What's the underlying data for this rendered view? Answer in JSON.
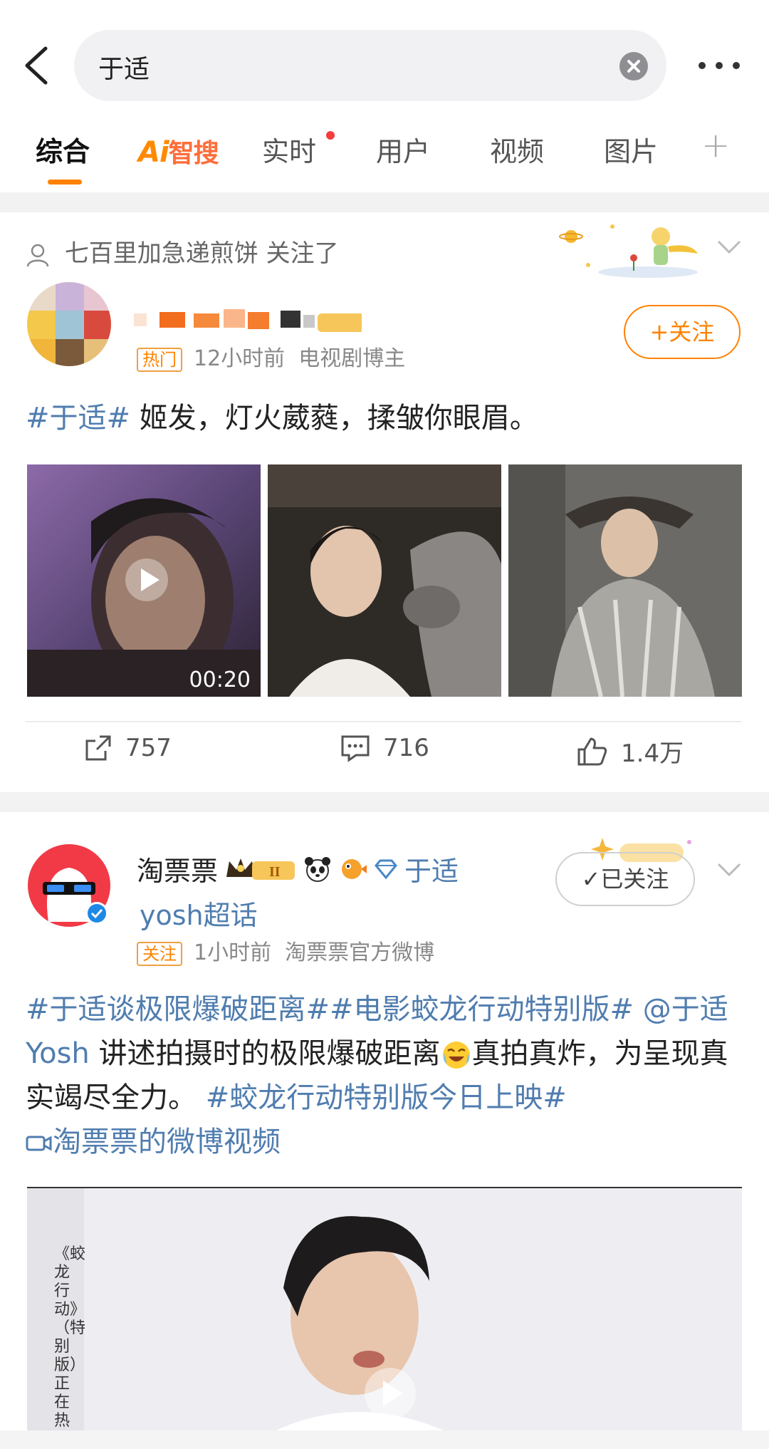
{
  "search": {
    "query": "于适"
  },
  "tabs": [
    {
      "label": "综合",
      "active": true
    },
    {
      "label": "智搜",
      "logo_prefix": "Ai"
    },
    {
      "label": "实时",
      "has_dot": true
    },
    {
      "label": "用户"
    },
    {
      "label": "视频"
    },
    {
      "label": "图片"
    },
    {
      "label": "+"
    }
  ],
  "colors": {
    "accent": "#ff8200",
    "link": "#507daf",
    "badge_red": "#f53d3d"
  },
  "post1": {
    "follow_note": "七百里加急递煎饼 关注了",
    "meta": {
      "tag": "热门",
      "time": "12小时前",
      "source": "电视剧博主"
    },
    "follow_label": "+关注",
    "content": {
      "hashtag": "#于适#",
      "text": " 姬发，灯火葳蕤，揉皱你眼眉。"
    },
    "video_duration": "00:20",
    "actions": {
      "repost": "757",
      "comment": "716",
      "like": "1.4万"
    }
  },
  "post2": {
    "user_name": "淘票票",
    "topic": "于适",
    "topic_sub": "yosh超话",
    "meta": {
      "tag": "关注",
      "time": "1小时前",
      "source": "淘票票官方微博"
    },
    "followed_label": "✓已关注",
    "content": {
      "tag1": "#于适谈极限爆破距离#",
      "tag2": "#电影蛟龙行动特别版#",
      "mention": " @于适 Yosh",
      "text1": " 讲述拍摄时的极限爆破距离",
      "text2": "真拍真炸，为呈现真实竭尽全力。",
      "tag3": "#蛟龙行动特别版今日上映#",
      "video_link": "淘票票的微博视频"
    },
    "video_side_text": "《蛟龙行动》（特别版）正在热映"
  }
}
